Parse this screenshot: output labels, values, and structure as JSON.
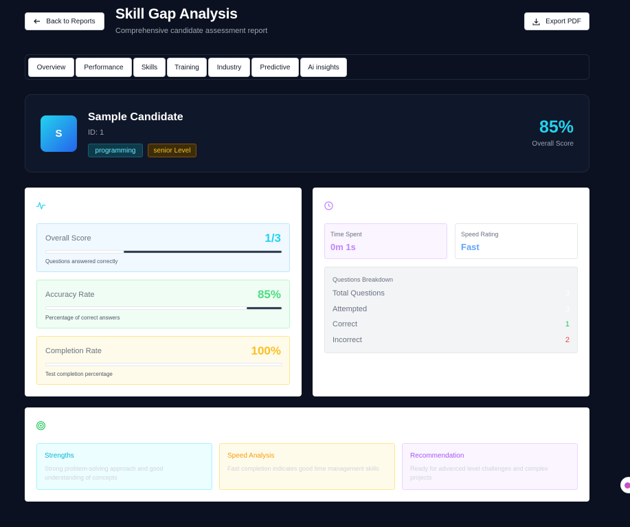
{
  "header": {
    "back_label": "Back to Reports",
    "title": "Skill Gap Analysis",
    "subtitle": "Comprehensive candidate assessment report",
    "export_label": "Export PDF"
  },
  "tabs": [
    "Overview",
    "Performance",
    "Skills",
    "Training",
    "Industry",
    "Predictive",
    "Ai insights"
  ],
  "candidate": {
    "initial": "S",
    "name": "Sample Candidate",
    "id": "ID: 1",
    "category_badge": "programming",
    "level_badge": "senior Level",
    "score": "85%",
    "score_label": "Overall Score"
  },
  "performance": {
    "icon": "activity-icon",
    "metrics": [
      {
        "label": "Overall Score",
        "value": "1/3",
        "fill_percent": 67,
        "sub": "Questions answered correctly",
        "color": "#22d3ee"
      },
      {
        "label": "Accuracy Rate",
        "value": "85%",
        "fill_percent": 15,
        "sub": "Percentage of correct answers",
        "color": "#4ade80"
      },
      {
        "label": "Completion Rate",
        "value": "100%",
        "fill_percent": 0,
        "sub": "Test completion percentage",
        "color": "#fbbf24"
      }
    ]
  },
  "timing": {
    "icon": "clock-icon",
    "time_spent_label": "Time Spent",
    "time_spent_value": "0m 1s",
    "speed_label": "Speed Rating",
    "speed_value": "Fast",
    "breakdown_title": "Questions Breakdown",
    "rows": [
      {
        "label": "Total Questions",
        "value": "3",
        "color": "#ffffff"
      },
      {
        "label": "Attempted",
        "value": "3",
        "color": "#ffffff"
      },
      {
        "label": "Correct",
        "value": "1",
        "color": "#22c55e"
      },
      {
        "label": "Incorrect",
        "value": "2",
        "color": "#ef4444"
      }
    ]
  },
  "insights": {
    "icon": "target-icon",
    "cards": [
      {
        "title": "Strengths",
        "text": "Strong problem-solving approach and good understanding of concepts",
        "color": "#06b6d4"
      },
      {
        "title": "Speed Analysis",
        "text": "Fast completion indicates good time management skills",
        "color": "#f59e0b"
      },
      {
        "title": "Recommendation",
        "text": "Ready for advanced level challenges and complex projects",
        "color": "#a855f7"
      }
    ]
  },
  "colors": {
    "background": "#0b1120",
    "accent_cyan": "#22d3ee",
    "time_purple": "#c084fc",
    "speed_blue": "#60a5fa"
  }
}
